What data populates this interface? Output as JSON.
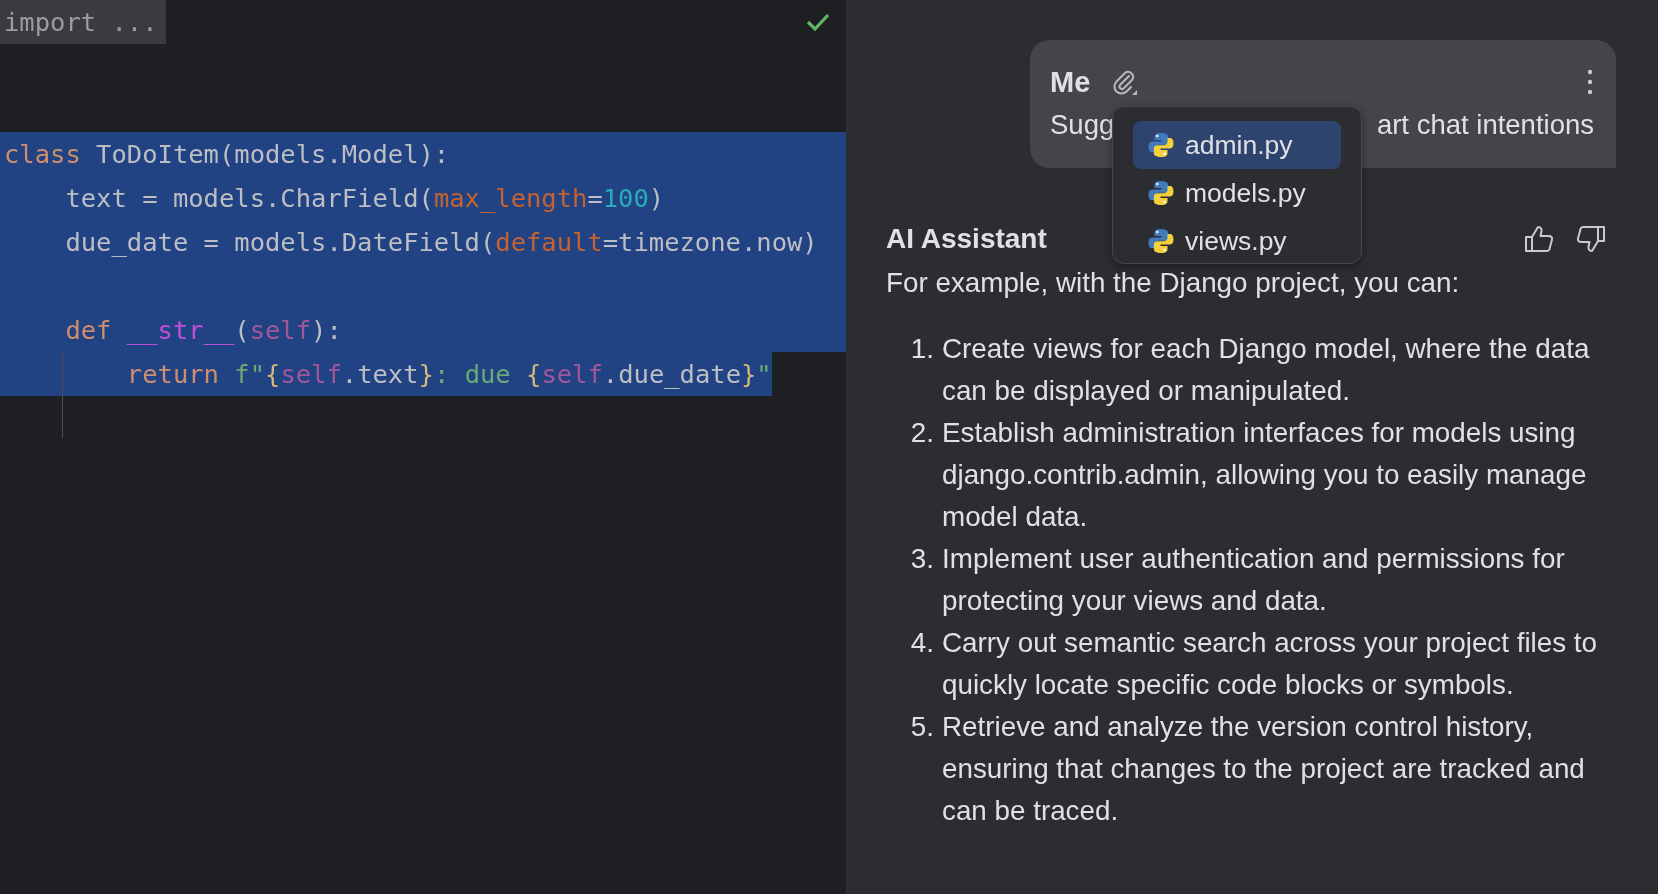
{
  "editor": {
    "folded_import": "import ...",
    "inspection_ok": true,
    "lines": [
      {
        "selected": true,
        "tokens": [
          {
            "kind": "keyword",
            "text": "class"
          },
          {
            "kind": "plain",
            "text": " ToDoItem(models.Model):"
          }
        ]
      },
      {
        "selected": true,
        "tokens": [
          {
            "kind": "plain",
            "text": "    text = models.CharField("
          },
          {
            "kind": "param",
            "text": "max_length"
          },
          {
            "kind": "plain",
            "text": "="
          },
          {
            "kind": "number",
            "text": "100"
          },
          {
            "kind": "plain",
            "text": ")"
          }
        ]
      },
      {
        "selected": true,
        "tokens": [
          {
            "kind": "plain",
            "text": "    due_date = models.DateField("
          },
          {
            "kind": "param",
            "text": "default"
          },
          {
            "kind": "plain",
            "text": "=timezone.now)"
          }
        ]
      },
      {
        "selected": true
      },
      {
        "selected": true,
        "tokens": [
          {
            "kind": "keyword",
            "text": "    def "
          },
          {
            "kind": "magic",
            "text": "__str__"
          },
          {
            "kind": "plain",
            "text": "("
          },
          {
            "kind": "self",
            "text": "self"
          },
          {
            "kind": "plain",
            "text": "):"
          }
        ]
      },
      {
        "selected": true,
        "tokens": [
          {
            "kind": "keyword",
            "text": "        return "
          },
          {
            "kind": "string",
            "text": "f\""
          },
          {
            "kind": "brace",
            "text": "{"
          },
          {
            "kind": "self",
            "text": "self"
          },
          {
            "kind": "plain",
            "text": ".text"
          },
          {
            "kind": "brace",
            "text": "}"
          },
          {
            "kind": "string",
            "text": ": due "
          },
          {
            "kind": "brace",
            "text": "{"
          },
          {
            "kind": "self",
            "text": "self"
          },
          {
            "kind": "plain",
            "text": ".due_date"
          },
          {
            "kind": "brace",
            "text": "}"
          },
          {
            "kind": "string",
            "text": "\""
          }
        ]
      }
    ]
  },
  "chat": {
    "user_message": {
      "author": "Me",
      "visible_start": "Sugg",
      "visible_end": "art chat intentions"
    },
    "attachment_menu": [
      {
        "name": "admin.py",
        "selected": true
      },
      {
        "name": "models.py",
        "selected": false
      },
      {
        "name": "views.py",
        "selected": false
      }
    ],
    "assistant": {
      "author": "AI Assistant",
      "intro": "For example, with the Django project, you can:",
      "items": [
        {
          "number": "1.",
          "text": "Create views for each Django model, where the data can be displayed or manipulated."
        },
        {
          "number": "2.",
          "text": "Establish administration interfaces for models using django.contrib.admin, allowing you to easily manage model data."
        },
        {
          "number": "3.",
          "text": "Implement user authentication and permissions for protecting your views and data."
        },
        {
          "number": "4.",
          "text": "Carry out semantic search across your project files to quickly locate specific code blocks or symbols."
        },
        {
          "number": "5.",
          "text": "Retrieve and analyze the version control history, ensuring that changes to the project are tracked and can be traced."
        }
      ]
    }
  }
}
